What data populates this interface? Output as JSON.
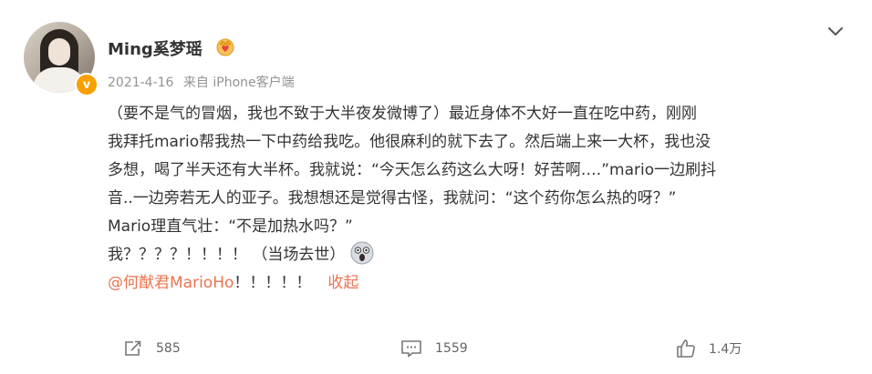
{
  "post": {
    "username": "Ming奚梦瑶",
    "date": "2021-4-16",
    "source": "来自 iPhone客户端",
    "lines": [
      "（要不是气的冒烟，我也不致于大半夜发微博了）最近身体不大好一直在吃中药，刚刚",
      "我拜托mario帮我热一下中药给我吃。他很麻利的就下去了。然后端上来一大杯，我也没",
      "多想，喝了半天还有大半杯。我就说：“今天怎么药这么大呀！好苦啊….”mario一边刷抖",
      "音..一边旁若无人的亚子。我想想还是觉得古怪，我就问：“这个药你怎么热的呀？”",
      "Mario理直气壮：“不是加热水吗？”",
      "我？？？？！！！！ （当场去世）"
    ],
    "mention": "@何猷君MarioHo",
    "mention_suffix": "！！！！！",
    "collapse_label": "收起",
    "repost_count": "585",
    "comment_count": "1559",
    "like_count": "1.4万"
  },
  "icons": {
    "badge": "v-verified-icon",
    "crown": "crown-heart-icon",
    "chevron": "chevron-down-icon",
    "shock": "shocked-face-emoji",
    "repost": "repost-icon",
    "comment": "comment-icon",
    "like": "thumbs-up-icon"
  },
  "colors": {
    "accent": "#eb7350",
    "meta": "#939393",
    "text": "#333333",
    "badge": "#f7a000"
  }
}
